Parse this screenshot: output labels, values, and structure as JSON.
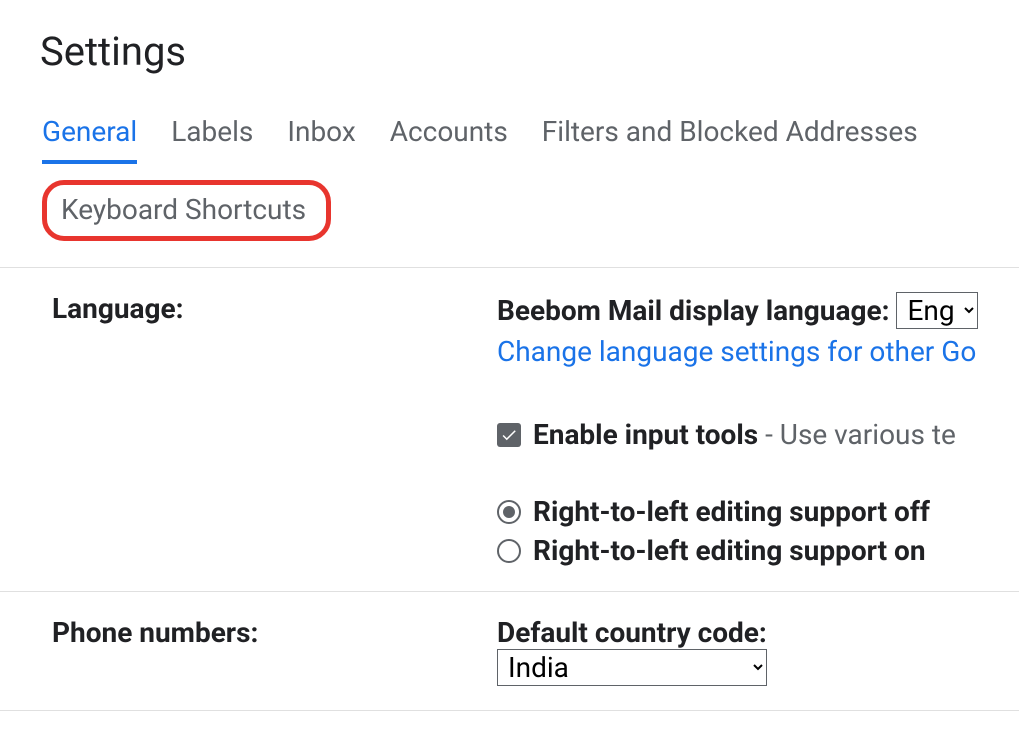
{
  "page_title": "Settings",
  "tabs": {
    "general": "General",
    "labels": "Labels",
    "inbox": "Inbox",
    "accounts": "Accounts",
    "filters": "Filters and Blocked Addresses",
    "keyboard_shortcuts": "Keyboard Shortcuts"
  },
  "language": {
    "label": "Language:",
    "display_label": "Beebom Mail display language: ",
    "select_value": "Eng",
    "change_link": "Change language settings for other Go",
    "checkbox_label": "Enable input tools",
    "checkbox_desc": " - Use various te",
    "radio_off": "Right-to-left editing support off",
    "radio_on": "Right-to-left editing support on"
  },
  "phone": {
    "label": "Phone numbers:",
    "prefix": "Default country code: ",
    "select_value": "India"
  }
}
